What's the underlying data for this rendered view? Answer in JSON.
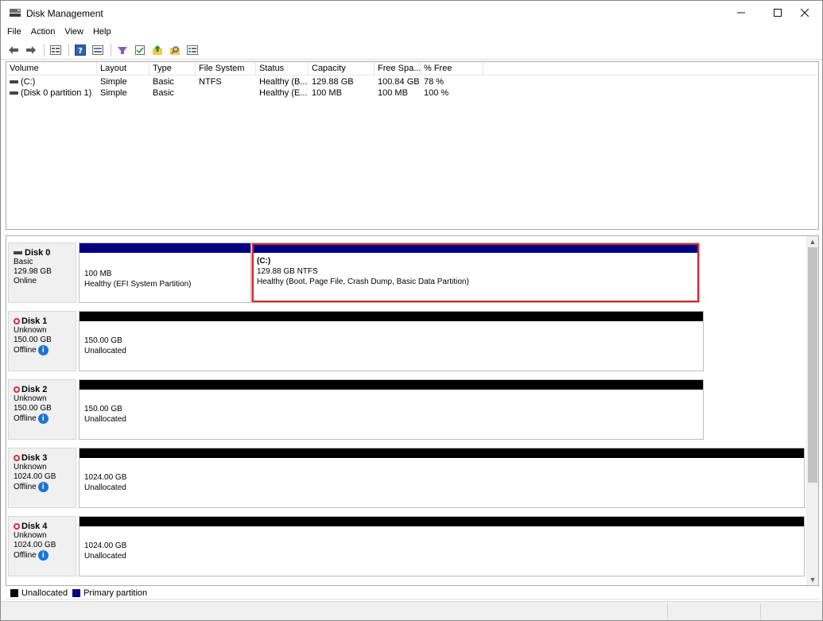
{
  "window": {
    "title": "Disk Management"
  },
  "menu": [
    {
      "label": "File"
    },
    {
      "label": "Action"
    },
    {
      "label": "View"
    },
    {
      "label": "Help"
    }
  ],
  "toolbar_icons": [
    "back-arrow-icon",
    "forward-arrow-icon",
    "properties-list-icon",
    "help-icon",
    "view-icon",
    "connect-icon",
    "checklist-icon",
    "up-folder-icon",
    "search-icon",
    "details-icon"
  ],
  "volumes_table": {
    "columns": [
      "Volume",
      "Layout",
      "Type",
      "File System",
      "Status",
      "Capacity",
      "Free Spa...",
      "% Free"
    ],
    "rows": [
      [
        "(C:)",
        "Simple",
        "Basic",
        "NTFS",
        "Healthy (B...",
        "129.88 GB",
        "100.84 GB",
        "78 %"
      ],
      [
        "(Disk 0 partition 1)",
        "Simple",
        "Basic",
        "",
        "Healthy (E...",
        "100 MB",
        "100 MB",
        "100 %"
      ]
    ]
  },
  "disks": [
    {
      "name": "Disk 0",
      "type": "Basic",
      "size": "129.98 GB",
      "state": "Online",
      "partitions": [
        {
          "label": "",
          "size": "100 MB",
          "status": "Healthy (EFI System Partition)"
        },
        {
          "label": "(C:)",
          "size": "129.88 GB NTFS",
          "status": "Healthy (Boot, Page File, Crash Dump, Basic Data Partition)"
        }
      ]
    },
    {
      "name": "Disk 1",
      "type": "Unknown",
      "size": "150.00 GB",
      "state": "Offline",
      "partitions": [
        {
          "size": "150.00 GB",
          "status": "Unallocated"
        }
      ]
    },
    {
      "name": "Disk 2",
      "type": "Unknown",
      "size": "150.00 GB",
      "state": "Offline",
      "partitions": [
        {
          "size": "150.00 GB",
          "status": "Unallocated"
        }
      ]
    },
    {
      "name": "Disk 3",
      "type": "Unknown",
      "size": "1024.00 GB",
      "state": "Offline",
      "partitions": [
        {
          "size": "1024.00 GB",
          "status": "Unallocated"
        }
      ]
    },
    {
      "name": "Disk 4",
      "type": "Unknown",
      "size": "1024.00 GB",
      "state": "Offline",
      "partitions": [
        {
          "size": "1024.00 GB",
          "status": "Unallocated"
        }
      ]
    }
  ],
  "legend": [
    {
      "label": "Unallocated",
      "color": "#000000"
    },
    {
      "label": "Primary partition",
      "color": "#020281"
    }
  ],
  "colors": {
    "primary_bar": "#020281",
    "unallocated_bar": "#000000",
    "selection_outline": "#d6262c",
    "offline_info": "#1e73d2"
  }
}
